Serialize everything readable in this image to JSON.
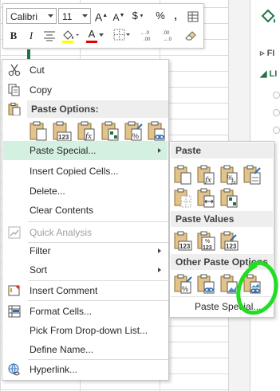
{
  "toolbar": {
    "font_name": "Calibri",
    "font_size": "11",
    "grow_font": "A",
    "shrink_font": "A",
    "currency": "$",
    "percent": "%",
    "comma": ",",
    "bold": "B",
    "italic": "I",
    "font_color": "A",
    "increase_decimal": "←.0 .00",
    "decrease_decimal": ".00 →.0"
  },
  "context_menu": {
    "cut": {
      "pre": "",
      "u": "t",
      "post": "",
      "full": "Cut"
    },
    "copy": "Copy",
    "paste_options_header": "Paste Options:",
    "paste_special": "Paste Special...",
    "insert_copied_cells": "Insert Copied Cells...",
    "delete": "Delete...",
    "clear_contents": "Clear Contents",
    "quick_analysis": "Quick Analysis",
    "filter": "Filter",
    "sort": "Sort",
    "insert_comment": "Insert Comment",
    "format_cells": "Format Cells...",
    "pick_from_list": "Pick From Drop-down List...",
    "define_name": "Define Name...",
    "hyperlink": "Hyperlink..."
  },
  "submenu": {
    "paste_header": "Paste",
    "paste_values_header": "Paste Values",
    "other_paste_header": "Other Paste Options",
    "footer": "Paste Special..."
  },
  "task_pane": {
    "row1": "FI",
    "row2": "LI"
  },
  "colors": {
    "excel_green": "#217346",
    "highlight": "#d3f0e0",
    "annotation": "#22dd22",
    "font_color_bar": "#e00000",
    "fill_color_bar": "#ffff00"
  }
}
